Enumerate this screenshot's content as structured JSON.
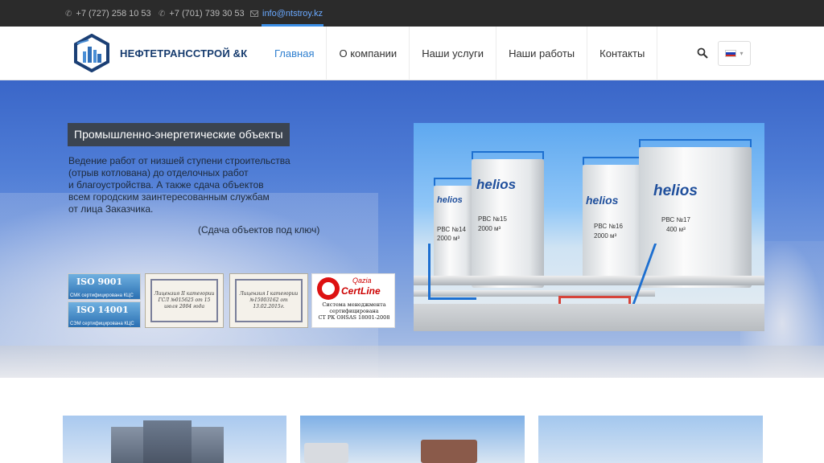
{
  "topbar": {
    "phone1": "+7 (727) 258 10 53",
    "phone2": "+7 (701) 739 30 53",
    "email": "info@ntstroy.kz",
    "phone_icon": "phone-icon",
    "email_icon": "envelope-icon"
  },
  "header": {
    "brand": "НЕФТЕТРАНССТРОЙ &К",
    "nav": [
      "Главная",
      "О компании",
      "Наши услуги",
      "Наши работы",
      "Контакты"
    ],
    "active_nav": "Главная",
    "search_icon": "search-icon",
    "language": "ru",
    "accent_color": "#2f7fcf"
  },
  "hero": {
    "title": "Промышленно-энергетические объекты",
    "desc_lines": [
      "Ведение работ от низшей ступени строительства",
      "(отрыв котлована) до отделочных работ",
      "и благоустройства. А также сдача объектов",
      "всем городским заинтересованным службам",
      "от лица Заказчика."
    ],
    "subtitle": "(Сдача объектов под ключ)"
  },
  "certs": {
    "iso1": "ISO 9001",
    "iso1_sub": "СМК сертифицирована КЦС",
    "iso2": "ISO 14001",
    "iso2_sub": "СЭМ сертифицирована КЦС",
    "license1": [
      "Лицензия II категории",
      "ГСЛ №015625 от 15",
      "июля 2004 года"
    ],
    "license2": [
      "Лицензия I категории",
      "№15003162 от 13.02.2015г."
    ],
    "certline_top": "Qazia",
    "certline_name": "CertLine",
    "certline_lines": [
      "Система менеджмента",
      "сертифицирована",
      "СТ РК OHSAS 18001-2008"
    ]
  },
  "photo": {
    "tanks": [
      {
        "brand": "helios",
        "label": "РВС №14",
        "volume": "2000 м³"
      },
      {
        "brand": "helios",
        "label": "РВС №15",
        "volume": "2000 м³"
      },
      {
        "brand": "helios",
        "label": "РВС №16",
        "volume": "2000 м³"
      },
      {
        "brand": "helios",
        "label": "РВС №17",
        "volume": "400 м³"
      }
    ]
  }
}
